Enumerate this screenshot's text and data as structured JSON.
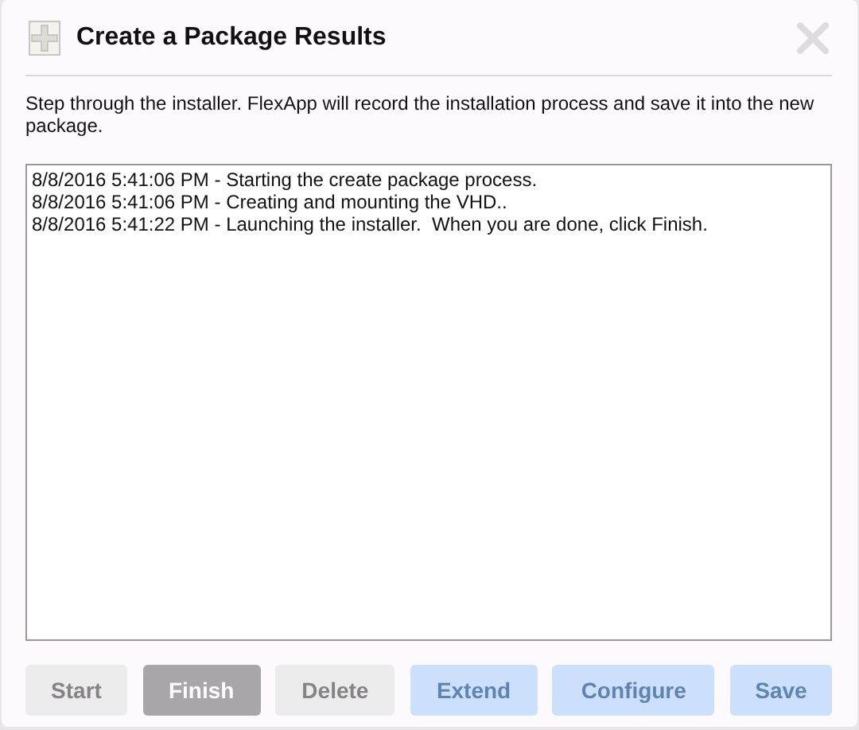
{
  "window": {
    "title": "Create a Package Results"
  },
  "description": "Step through the installer. FlexApp will record the installation process and save it into the new package.",
  "log": [
    "8/8/2016 5:41:06 PM - Starting the create package process.",
    "8/8/2016 5:41:06 PM - Creating and mounting the VHD..",
    "8/8/2016 5:41:22 PM - Launching the installer.  When you are done, click Finish."
  ],
  "buttons": [
    {
      "label": "Start",
      "kind": "grey",
      "disabled": true
    },
    {
      "label": "Finish",
      "kind": "grey",
      "disabled": false
    },
    {
      "label": "Delete",
      "kind": "grey",
      "disabled": true
    },
    {
      "label": "Extend",
      "kind": "blue",
      "disabled": true
    },
    {
      "label": "Configure",
      "kind": "blue",
      "disabled": true
    },
    {
      "label": "Save",
      "kind": "blue",
      "disabled": true
    }
  ]
}
